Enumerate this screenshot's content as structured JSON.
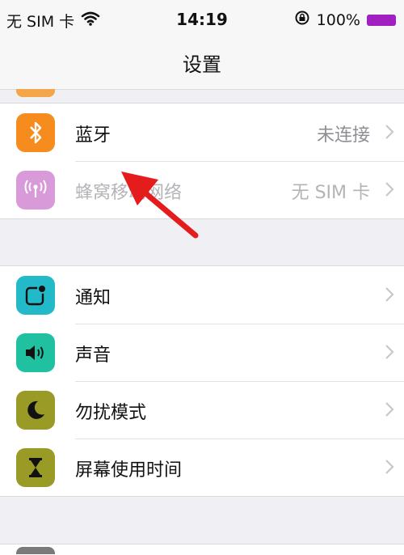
{
  "status_bar": {
    "carrier": "无 SIM 卡",
    "time": "14:19",
    "battery": "100%",
    "icons": [
      "wifi-icon",
      "orientation-lock-icon",
      "battery-icon"
    ]
  },
  "nav": {
    "title": "设置"
  },
  "group1": [
    {
      "label": "蓝牙",
      "value": "未连接",
      "icon": "bluetooth-icon",
      "color": "#f58c1d"
    },
    {
      "label": "蜂窝移动网络",
      "value": "无 SIM 卡",
      "icon": "antenna-icon",
      "color": "#d99ad9",
      "dimmed": true
    }
  ],
  "group2": [
    {
      "label": "通知",
      "icon": "notifications-icon",
      "color": "#22b9c9"
    },
    {
      "label": "声音",
      "icon": "speaker-icon",
      "color": "#1fc1a0"
    },
    {
      "label": "勿扰模式",
      "icon": "moon-icon",
      "color": "#9a9a26"
    },
    {
      "label": "屏幕使用时间",
      "icon": "hourglass-icon",
      "color": "#9a9a26"
    }
  ],
  "annotation": {
    "icon": "red-arrow-icon",
    "color": "#e41c1c"
  }
}
